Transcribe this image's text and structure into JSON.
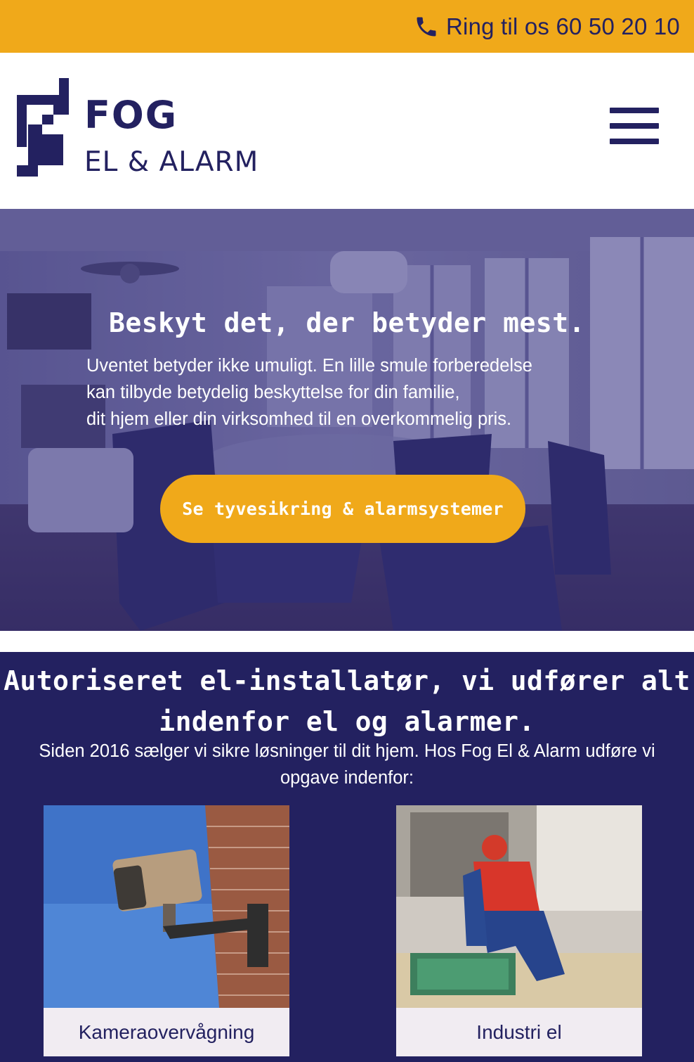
{
  "topbar": {
    "phone_label": "Ring til os 60 50 20 10",
    "phone_icon": "phone-icon",
    "background": "#f0a91a"
  },
  "header": {
    "logo": {
      "line1": "FOG",
      "line2": "EL & ALARM"
    },
    "menu_icon": "hamburger-menu-icon"
  },
  "hero": {
    "title": "Beskyt det, der betyder mest.",
    "text_lines": [
      "Uventet betyder ikke umuligt. En lille smule forberedelse",
      "kan tilbyde betydelig beskyttelse for din familie,",
      "dit hjem eller din virksomhed til en overkommelig pris."
    ],
    "button_label": "Se tyvesikring & alarmsystemer"
  },
  "services": {
    "title_lines": [
      "Autoriseret el-installatør, vi udfører alt",
      "indenfor el og alarmer."
    ],
    "text_lines": [
      "Siden 2016 sælger vi sikre løsninger til dit hjem. Hos Fog El & Alarm udføre vi",
      "opgave indenfor:"
    ],
    "cards": [
      {
        "label": "Kameraovervågning"
      },
      {
        "label": "Industri el"
      }
    ]
  },
  "colors": {
    "brand_navy": "#232160",
    "accent_yellow": "#f0a91a",
    "card_label_bg": "#f1ecf2"
  }
}
